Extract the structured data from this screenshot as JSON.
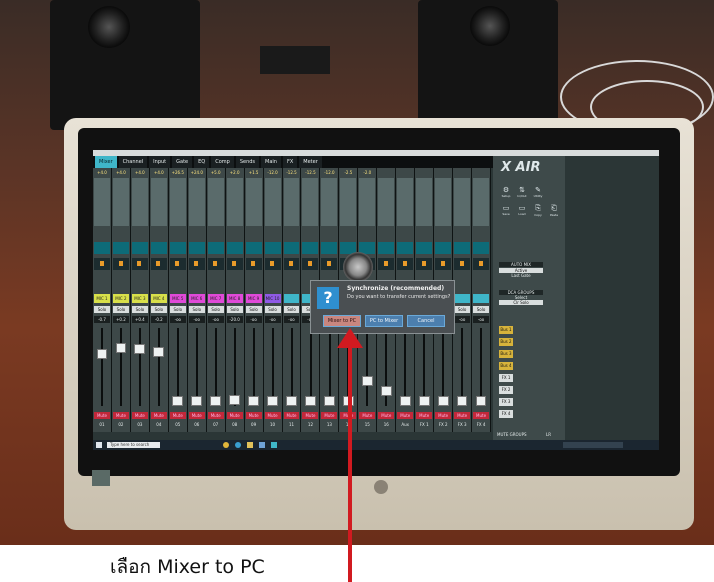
{
  "caption": "เลือก Mixer to  PC",
  "app": {
    "tabs": [
      "Mixer",
      "Channel",
      "Input",
      "Gate",
      "EQ",
      "Comp",
      "Sends",
      "Main",
      "FX",
      "Meter"
    ],
    "gains": [
      "+4.0",
      "+4.0",
      "+4.0",
      "+4.0",
      "+26.5",
      "+24.0",
      "+5.0",
      "+2.0",
      "+1.5",
      "-12.0",
      "-12.5",
      "-12.5",
      "-12.0",
      "-2.5",
      "-2.0"
    ],
    "channel_names": [
      "MIC 1",
      "MIC 2",
      "MIC 3",
      "MIC 4",
      "MIC 5",
      "MIC 6",
      "MIC 7",
      "MIC 8",
      "MIC 9",
      "MIC 10",
      "",
      "",
      "",
      "",
      "",
      "",
      "",
      "",
      "",
      "",
      ""
    ],
    "solo_label": "Solo",
    "mute_label": "Mute",
    "db_values": [
      "-0.7",
      "+0.2",
      "+0.4",
      "-0.2",
      "-oo",
      "-oo",
      "-oo",
      "-20.0",
      "-oo",
      "-oo",
      "-oo",
      "-oo",
      "-oo",
      "-oo",
      "-oo",
      "-oo",
      "-oo",
      "-oo",
      "-oo",
      "-oo",
      "-oo"
    ],
    "fader_levels": [
      0.72,
      0.8,
      0.78,
      0.75,
      0.08,
      0.08,
      0.08,
      0.1,
      0.08,
      0.08,
      0.08,
      0.08,
      0.08,
      0.08,
      0.35,
      0.22,
      0.08,
      0.08,
      0.08,
      0.08,
      0.08
    ],
    "channel_numbers": [
      "01",
      "02",
      "03",
      "04",
      "05",
      "06",
      "07",
      "08",
      "09",
      "10",
      "11",
      "12",
      "13",
      "14",
      "15",
      "16",
      "Aux",
      "FX 1",
      "FX 2",
      "FX 3",
      "FX 4"
    ],
    "logo": "X AIR",
    "tools": [
      {
        "label": "Setup",
        "glyph": "⚙"
      },
      {
        "label": "In/Out",
        "glyph": "⇅"
      },
      {
        "label": "Utility",
        "glyph": "✎"
      },
      {
        "label": "Save",
        "glyph": "▭"
      },
      {
        "label": "Load",
        "glyph": "▭"
      },
      {
        "label": "Copy",
        "glyph": "⎘"
      },
      {
        "label": "Paste",
        "glyph": "⎗"
      }
    ],
    "automix_title": "AUTO MIX",
    "automix_active": "Active",
    "automix_gain": "Last Gate",
    "dca_title": "DCA GROUPS",
    "dca_select": "Select",
    "dca_clr_solo": "Clr Solo",
    "dca_labels": [
      "Bus 1",
      "Bus 2",
      "Bus 3",
      "Bus 4",
      "FX 1",
      "FX 2",
      "FX 3",
      "FX 4"
    ],
    "mute_groups_title": "MUTE GROUPS",
    "mute_groups_label": "LR",
    "dialog": {
      "title": "Synchronize (recommended)",
      "text": "Do you want to transfer current settings?",
      "buttons": [
        "Mixer to PC",
        "PC to Mixer",
        "Cancel"
      ]
    },
    "taskbar_search": "Type here to search",
    "colors": {
      "cyan": "#3fb6c9",
      "mute": "#c2283a",
      "dca": "#d7b33b",
      "arrow": "#d11a20"
    }
  }
}
